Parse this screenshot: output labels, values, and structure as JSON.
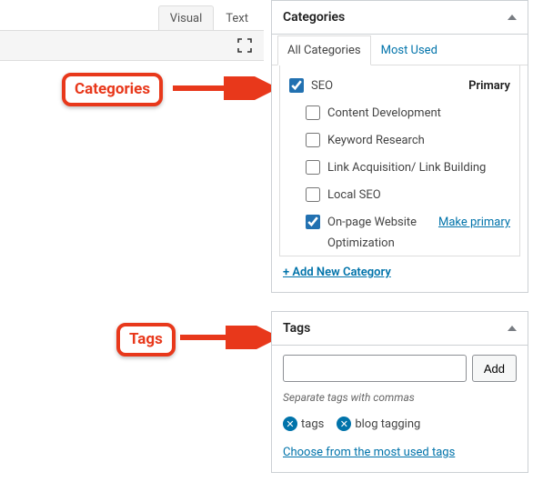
{
  "editor": {
    "tabs": {
      "visual": "Visual",
      "text": "Text"
    }
  },
  "annotations": {
    "categories_label": "Categories",
    "tags_label": "Tags"
  },
  "categories_panel": {
    "title": "Categories",
    "tab_all": "All Categories",
    "tab_most_used": "Most Used",
    "primary_label": "Primary",
    "make_primary_label": "Make primary",
    "items": [
      {
        "label": "SEO",
        "checked": true,
        "primary": true
      },
      {
        "label": "Content Development",
        "checked": false
      },
      {
        "label": "Keyword Research",
        "checked": false
      },
      {
        "label": "Link Acquisition/ Link Building",
        "checked": false
      },
      {
        "label": "Local SEO",
        "checked": false
      },
      {
        "label": "On-page Website Optimization",
        "checked": true,
        "make_primary": true
      }
    ],
    "add_new": "+ Add New Category"
  },
  "tags_panel": {
    "title": "Tags",
    "add_button": "Add",
    "input_value": "",
    "hint": "Separate tags with commas",
    "tags": [
      {
        "label": "tags"
      },
      {
        "label": "blog tagging"
      }
    ],
    "choose_link": "Choose from the most used tags"
  }
}
